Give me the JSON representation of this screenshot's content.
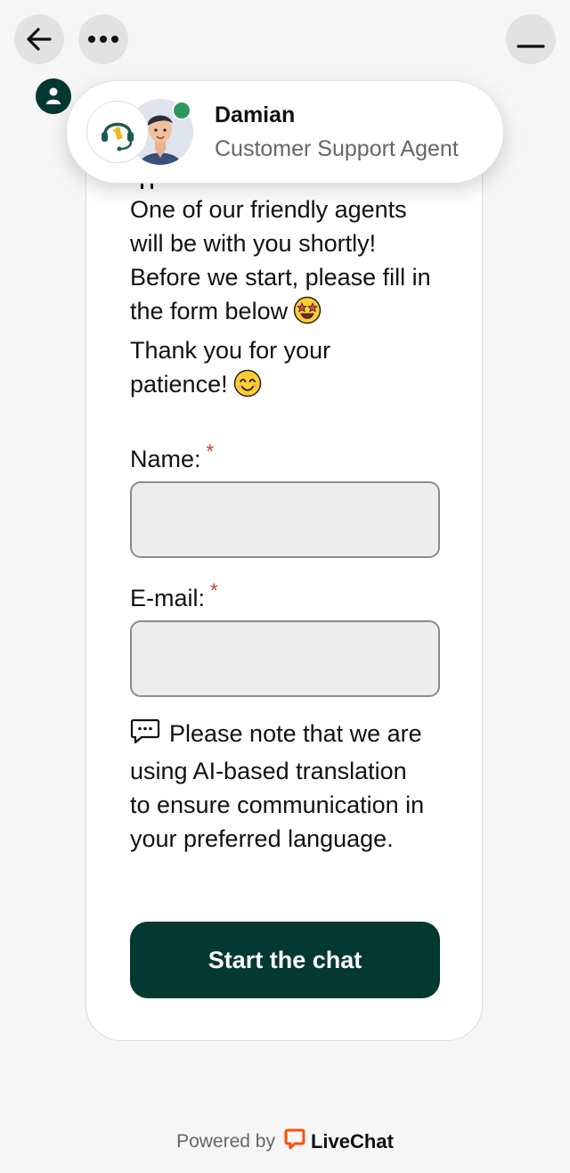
{
  "header": {
    "back_icon": "arrow-left-icon",
    "more_icon": "more-dots-icon",
    "minimize_icon": "minimize-icon"
  },
  "agent": {
    "name": "Damian",
    "role": "Customer Support Agent",
    "status_color": "#2c9a5c"
  },
  "message": {
    "lines": [
      "One of our friendly agents",
      "will be with you shortly!",
      "Before we start, please fill in",
      "the form below",
      "Thank you for your",
      "patience!"
    ],
    "emoji_1": "star-struck-emoji-icon",
    "emoji_2": "smiling-face-emoji-icon"
  },
  "form": {
    "name_label": "Name:",
    "email_label": "E-mail:",
    "required_mark": "*",
    "name_value": "",
    "email_value": ""
  },
  "note": {
    "lines": [
      "Please note that we are",
      "using AI-based translation",
      "to ensure communication in",
      "your preferred language."
    ]
  },
  "start_button_label": "Start the chat",
  "footer": {
    "powered_by": "Powered by",
    "brand": "LiveChat"
  },
  "colors": {
    "primary": "#043832",
    "required": "#d0342c",
    "background": "#f6f6f6",
    "brand_orange": "#ff5100"
  }
}
